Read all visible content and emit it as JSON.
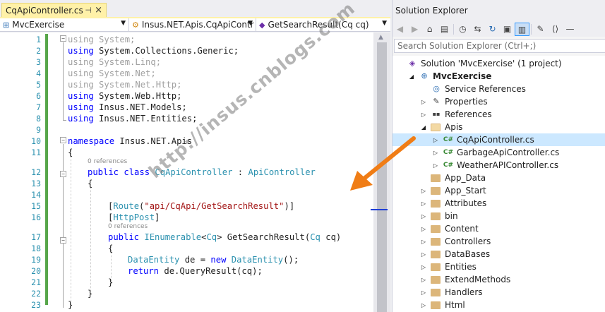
{
  "editor": {
    "tab": {
      "title": "CqApiController.cs",
      "pin_glyph": "⊣",
      "close_glyph": "×"
    },
    "nav": {
      "project": "MvcExercise",
      "class": "Insus.NET.Apis.CqApiContr",
      "member": "GetSearchResult(Cq cq)"
    },
    "line_numbers": [
      "1",
      "2",
      "3",
      "4",
      "5",
      "6",
      "7",
      "8",
      "9",
      "10",
      "11",
      "12",
      "13",
      "14",
      "15",
      "16",
      "17",
      "18",
      "19",
      "20",
      "21",
      "22",
      "23"
    ],
    "code": {
      "l1": [
        "using",
        " System;"
      ],
      "l2": [
        "using",
        " System.Collections.Generic;"
      ],
      "l3": [
        "using",
        " System.Linq;"
      ],
      "l4": [
        "using",
        " System.Net;"
      ],
      "l5": [
        "using",
        " System.Net.Http;"
      ],
      "l6": [
        "using",
        " System.Web.Http;"
      ],
      "l7": [
        "using",
        " Insus.NET.Models;"
      ],
      "l8": [
        "using",
        " Insus.NET.Entities;"
      ],
      "l10": [
        "namespace",
        " Insus.NET.Apis"
      ],
      "l11": "{",
      "refs_class": "0 references",
      "l12": [
        "public",
        " ",
        "class",
        " ",
        "CqApiController",
        " : ",
        "ApiController"
      ],
      "l13": "{",
      "l15": [
        "[",
        "Route",
        "(",
        "\"api/CqApi/GetSearchResult\"",
        ")]"
      ],
      "l16": [
        "[",
        "HttpPost",
        "]"
      ],
      "refs_method": "0 references",
      "l17": [
        "public",
        " ",
        "IEnumerable",
        "<",
        "Cq",
        "> GetSearchResult(",
        "Cq",
        " cq)"
      ],
      "l18": "{",
      "l19": [
        "DataEntity",
        " de = ",
        "new",
        " ",
        "DataEntity",
        "();"
      ],
      "l20": [
        "return",
        " de.QueryResult(cq);"
      ],
      "l21": "}",
      "l22": "}",
      "l23": "}"
    },
    "outline_glyph": "−"
  },
  "solution_explorer": {
    "title": "Solution Explorer",
    "search_placeholder": "Search Solution Explorer (Ctrl+;)",
    "toolbar": [
      "back-icon",
      "forward-icon",
      "home-icon",
      "switch-views-icon",
      "history-icon",
      "sync-icon",
      "refresh-icon",
      "collapse-all-icon",
      "show-all-files-icon",
      "properties-icon",
      "preview-icon"
    ],
    "tree": [
      {
        "label": "Solution 'MvcExercise' (1 project)",
        "icon": "solution-icon",
        "depth": 0,
        "expander": ""
      },
      {
        "label": "MvcExercise",
        "icon": "web-project-icon",
        "depth": 1,
        "expander": "expanded",
        "bold": true
      },
      {
        "label": "Service References",
        "icon": "service-references-icon",
        "depth": 2,
        "expander": ""
      },
      {
        "label": "Properties",
        "icon": "wrench-icon",
        "depth": 2,
        "expander": "collapsed"
      },
      {
        "label": "References",
        "icon": "references-icon",
        "depth": 2,
        "expander": "collapsed"
      },
      {
        "label": "Apis",
        "icon": "folder-open-icon",
        "depth": 2,
        "expander": "expanded"
      },
      {
        "label": "CqApiController.cs",
        "icon": "csharp-file-icon",
        "depth": 3,
        "expander": "collapsed",
        "selected": true
      },
      {
        "label": "GarbageApiController.cs",
        "icon": "csharp-file-icon",
        "depth": 3,
        "expander": "collapsed"
      },
      {
        "label": "WeatherAPIController.cs",
        "icon": "csharp-file-icon",
        "depth": 3,
        "expander": "collapsed"
      },
      {
        "label": "App_Data",
        "icon": "folder-icon",
        "depth": 2,
        "expander": ""
      },
      {
        "label": "App_Start",
        "icon": "folder-icon",
        "depth": 2,
        "expander": "collapsed"
      },
      {
        "label": "Attributes",
        "icon": "folder-icon",
        "depth": 2,
        "expander": "collapsed"
      },
      {
        "label": "bin",
        "icon": "folder-icon",
        "depth": 2,
        "expander": "collapsed"
      },
      {
        "label": "Content",
        "icon": "folder-icon",
        "depth": 2,
        "expander": "collapsed"
      },
      {
        "label": "Controllers",
        "icon": "folder-icon",
        "depth": 2,
        "expander": "collapsed"
      },
      {
        "label": "DataBases",
        "icon": "folder-icon",
        "depth": 2,
        "expander": "collapsed"
      },
      {
        "label": "Entities",
        "icon": "folder-icon",
        "depth": 2,
        "expander": "collapsed"
      },
      {
        "label": "ExtendMethods",
        "icon": "folder-icon",
        "depth": 2,
        "expander": "collapsed"
      },
      {
        "label": "Handlers",
        "icon": "folder-icon",
        "depth": 2,
        "expander": "collapsed"
      },
      {
        "label": "Html",
        "icon": "folder-icon",
        "depth": 2,
        "expander": "collapsed"
      }
    ]
  },
  "watermark": "http://insus.cnblogs.com",
  "colors": {
    "tab_active": "#fff1a8",
    "keyword": "#0000ff",
    "type": "#2b91af",
    "string": "#a31515",
    "arrow": "#f07d16",
    "selection": "#cce8ff"
  }
}
